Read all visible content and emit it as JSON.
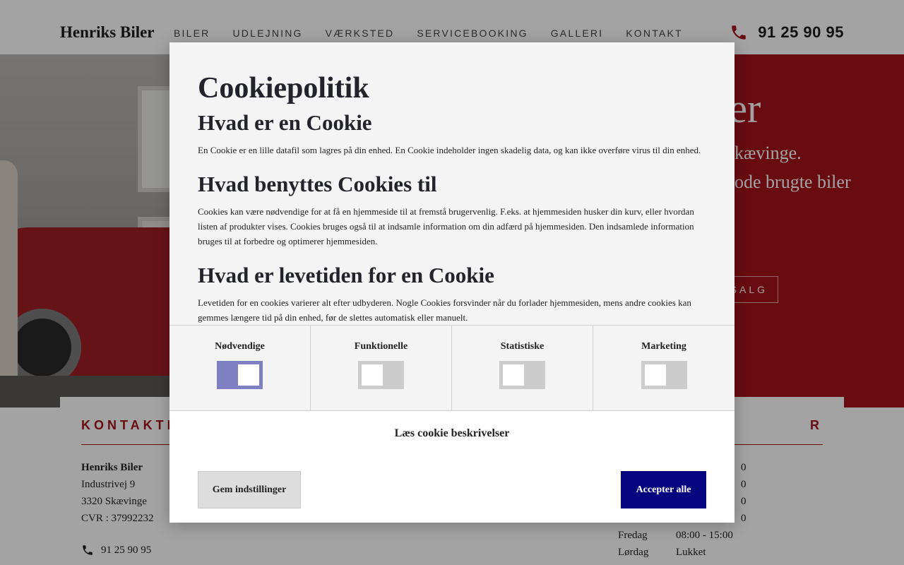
{
  "header": {
    "brand": "Henriks Biler",
    "nav": [
      "BILER",
      "UDLEJNING",
      "VÆRKSTED",
      "SERVICEBOOKING",
      "GALLERI",
      "KONTAKT"
    ],
    "phone": "91 25 90 95",
    "phone_icon": "phone-icon"
  },
  "hero": {
    "title": "iler",
    "sub1": "kævinge.",
    "sub2": "ode brugte biler",
    "button": "SALG"
  },
  "contact": {
    "title": "KONTAKTI",
    "name": "Henriks Biler",
    "street": "Industrivej 9",
    "city": "3320 Skævinge",
    "cvr": "CVR : 37992232",
    "phone": "91 25 90 95"
  },
  "hours": {
    "title": "R",
    "rows": [
      {
        "day": "",
        "time": "0"
      },
      {
        "day": "",
        "time": "0"
      },
      {
        "day": "",
        "time": "0"
      },
      {
        "day": "",
        "time": "0"
      },
      {
        "day": "Fredag",
        "time": "08:00 - 15:00"
      },
      {
        "day": "Lørdag",
        "time": "Lukket"
      }
    ]
  },
  "cookie": {
    "title": "Cookiepolitik",
    "sections": [
      {
        "heading": "Hvad er en Cookie",
        "text": "En Cookie er en lille datafil som lagres på din enhed. En Cookie indeholder ingen skadelig data, og kan ikke overføre virus til din enhed."
      },
      {
        "heading": "Hvad benyttes Cookies til",
        "text": "Cookies kan være nødvendige for at få en hjemmeside til at fremstå brugervenlig. F.eks. at hjemmesiden husker din kurv, eller hvordan listen af produkter vises. Cookies bruges også til at indsamle information om din adfærd på hjemmesiden. Den indsamlede information bruges til at forbedre og optimerer hjemmesiden."
      },
      {
        "heading": "Hvad er levetiden for en Cookie",
        "text": "Levetiden for en cookies varierer alt efter udbyderen. Nogle Cookies forsvinder når du forlader hjemmesiden, mens andre cookies kan gemmes længere tid på din enhed, før de slettes automatisk eller manuelt."
      }
    ],
    "toggles": [
      {
        "label": "Nødvendige",
        "on": true
      },
      {
        "label": "Funktionelle",
        "on": false
      },
      {
        "label": "Statistiske",
        "on": false
      },
      {
        "label": "Marketing",
        "on": false
      }
    ],
    "read_descriptions": "Læs cookie beskrivelser",
    "save_button": "Gem indstillinger",
    "accept_button": "Accepter alle",
    "accent_color": "#05057f",
    "toggle_on_color": "#7f80c2"
  }
}
